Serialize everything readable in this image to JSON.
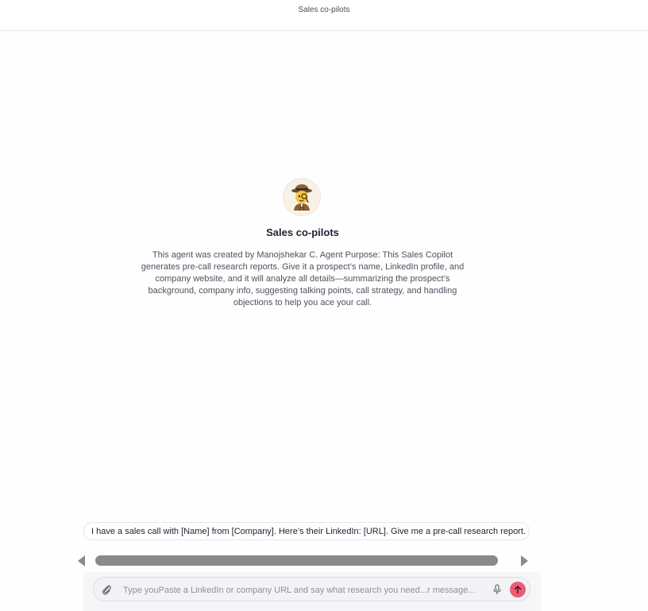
{
  "header": {
    "title": "Sales co-pilots"
  },
  "agent": {
    "name": "Sales co-pilots",
    "avatar_icon": "detective-emoji-icon",
    "description": "This agent was created by Manojshekar C. Agent Purpose: This Sales Copilot generates pre-call research reports. Give it a prospect’s name, LinkedIn profile, and company website, and it will analyze all details—summarizing the prospect’s background, company info, suggesting talking points, call strategy, and handling objections to help you ace your call."
  },
  "suggestions": [
    "I have a sales call with [Name] from [Company]. Here’s their LinkedIn: [URL]. Give me a pre-call research report."
  ],
  "composer": {
    "value": "",
    "placeholder": "Type youPaste a LinkedIn or company URL and say what research you need...r message...",
    "attach_icon": "paperclip-icon",
    "mic_icon": "microphone-icon",
    "send_icon": "arrow-up-icon",
    "send_color": "#ee5a72"
  }
}
